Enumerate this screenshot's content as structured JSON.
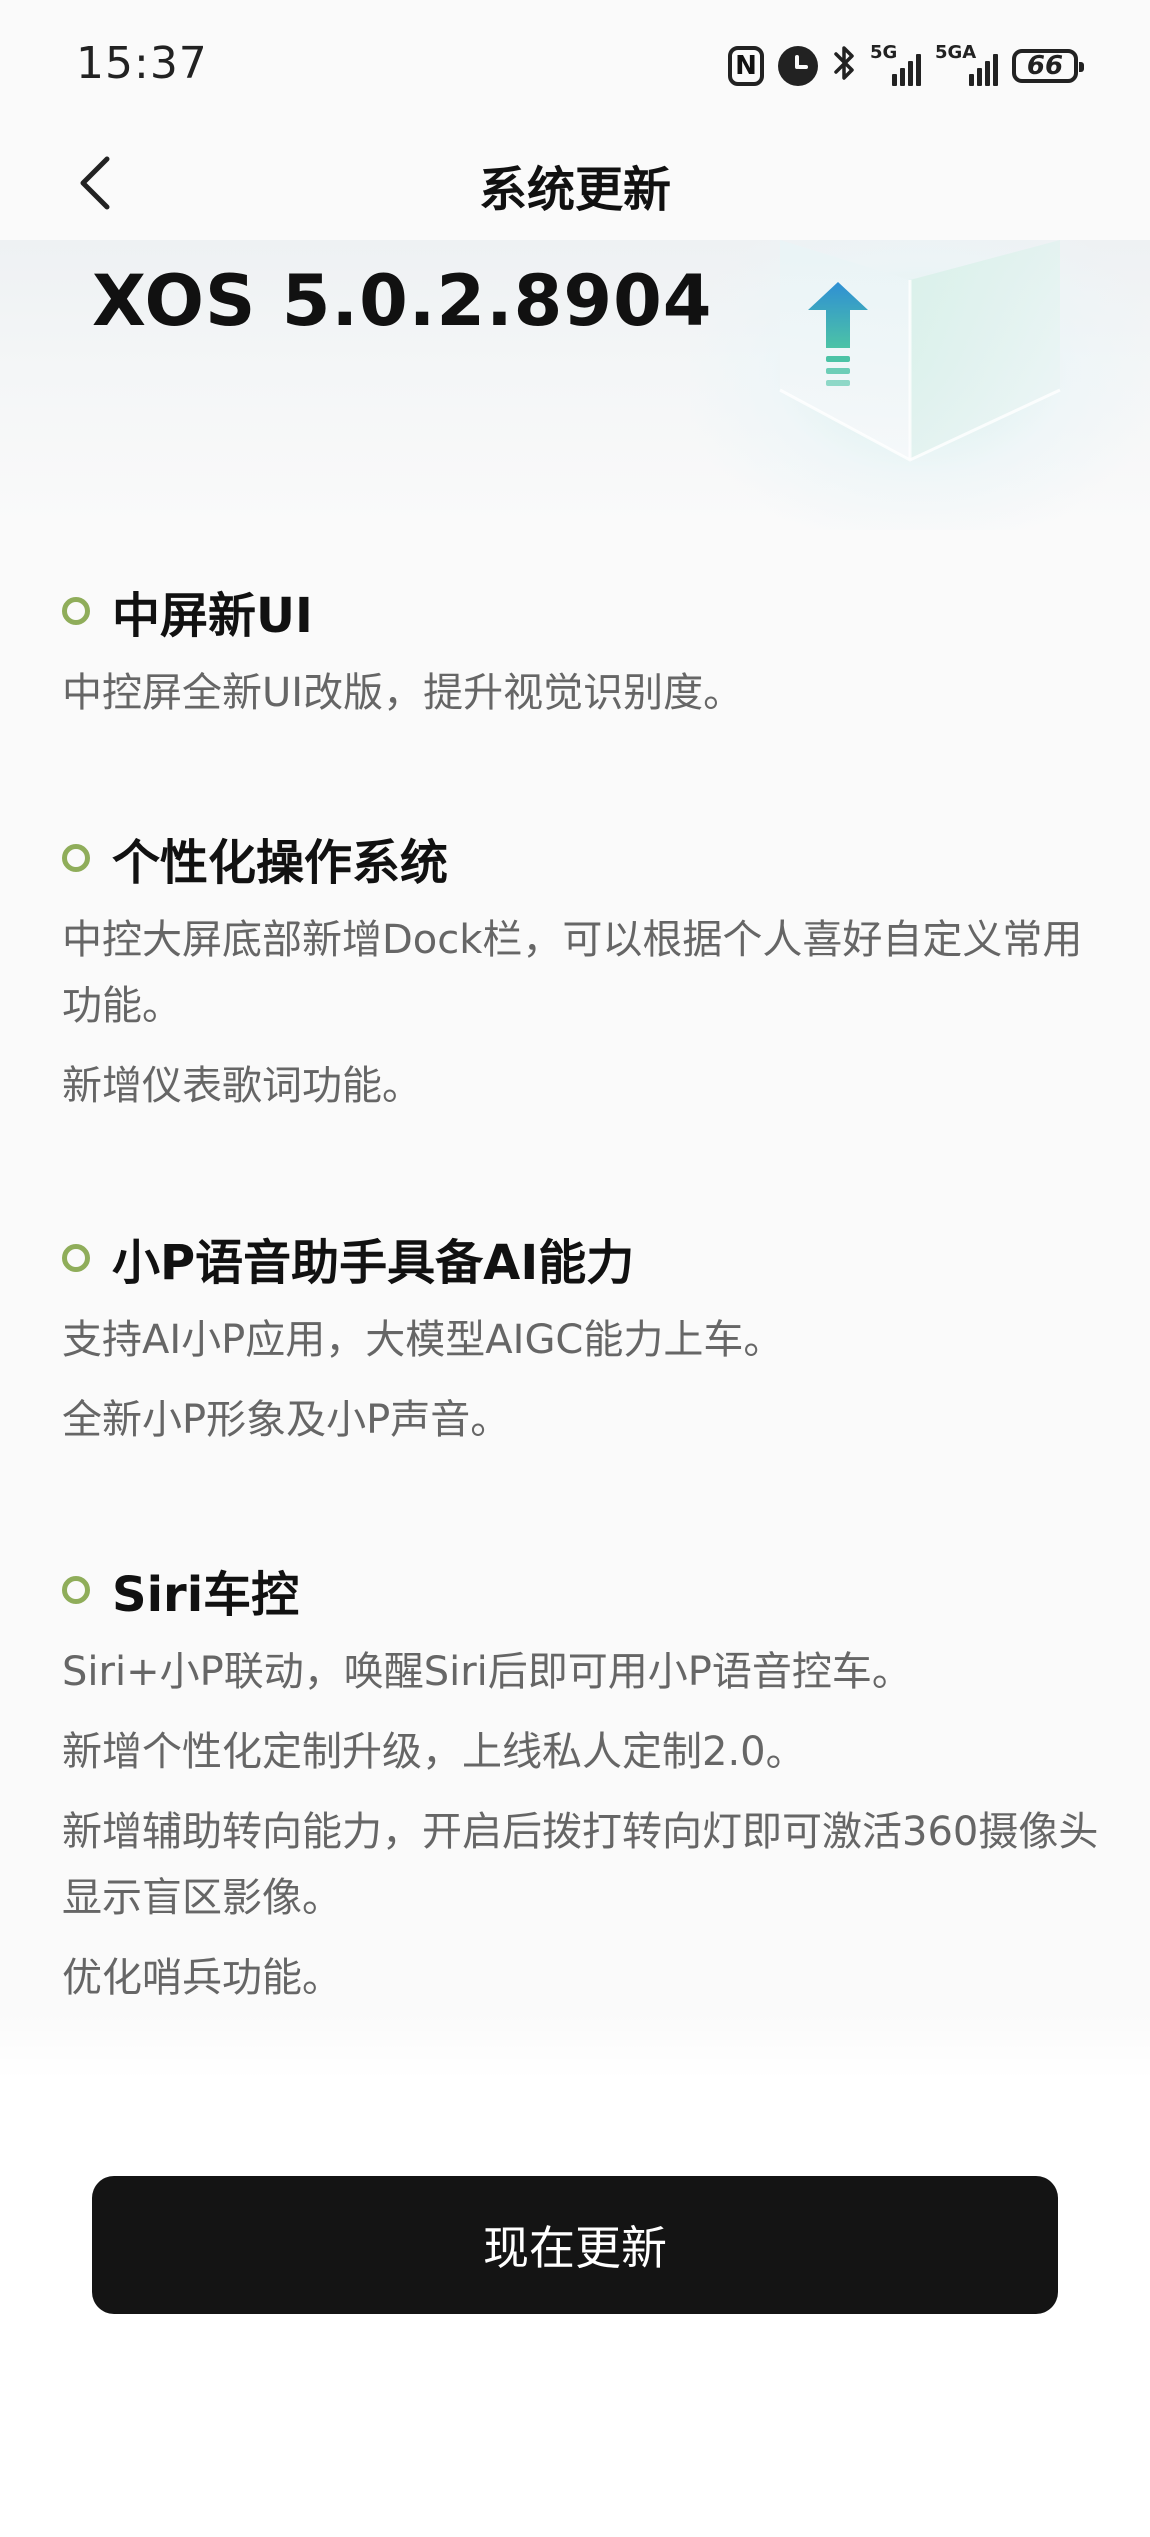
{
  "status_bar": {
    "time": "15:37",
    "icons": [
      "nfc-icon",
      "alarm-icon",
      "bluetooth-icon",
      "signal-5g-icon",
      "signal-5ga-icon",
      "battery-icon"
    ],
    "signal1_label": "5G",
    "signal2_label": "5GA",
    "battery_level": "66"
  },
  "nav": {
    "back_icon": "chevron-left-icon",
    "title": "系统更新"
  },
  "hero": {
    "version": "XOS 5.0.2.8904",
    "art_icon": "upgrade-cube-icon",
    "accent_color": "#3aa5c8"
  },
  "sections": [
    {
      "title": "中屏新UI",
      "items": [
        "中控屏全新UI改版，提升视觉识别度。"
      ]
    },
    {
      "title": "个性化操作系统",
      "items": [
        "中控大屏底部新增Dock栏，可以根据个人喜好自定义常用功能。",
        "新增仪表歌词功能。"
      ]
    },
    {
      "title": "小P语音助手具备AI能力",
      "items": [
        "支持AI小P应用，大模型AIGC能力上车。",
        "全新小P形象及小P声音。"
      ]
    },
    {
      "title": "Siri车控",
      "items": [
        "Siri+小P联动，唤醒Siri后即可用小P语音控车。",
        "新增个性化定制升级，上线私人定制2.0。",
        "新增辅助转向能力，开启后拨打转向灯即可激活360摄像头显示盲区影像。",
        "优化哨兵功能。"
      ]
    }
  ],
  "bullet_color": "#8fad5a",
  "actions": {
    "update_label": "现在更新",
    "update_color": "#141414"
  }
}
